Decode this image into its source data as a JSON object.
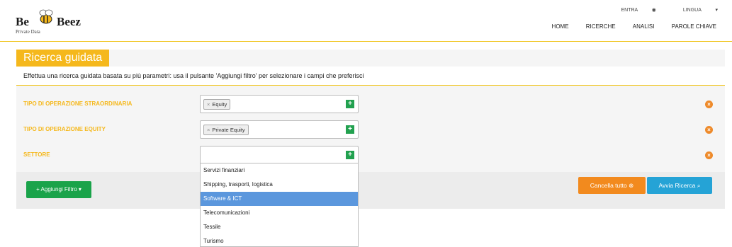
{
  "brand": {
    "name_left": "Be",
    "name_right": "Beez",
    "tagline": "Private Data"
  },
  "top_links": {
    "login": "ENTRA",
    "language": "LINGUA"
  },
  "nav": [
    "HOME",
    "RICERCHE",
    "ANALISI",
    "PAROLE CHIAVE"
  ],
  "page": {
    "title": "Ricerca guidata",
    "intro": "Effettua una ricerca guidata basata su più parametri: usa il pulsante 'Aggiungi filtro' per selezionare i campi che preferisci"
  },
  "filters": [
    {
      "label": "TIPO DI OPERAZIONE STRAORDINARIA",
      "tag": "Equity"
    },
    {
      "label": "TIPO DI OPERAZIONE EQUITY",
      "tag": "Private Equity"
    },
    {
      "label": "SETTORE",
      "tag": ""
    }
  ],
  "dropdown": [
    "Servizi finanziari",
    "Shipping, trasporti, logistica",
    "Software & ICT",
    "Telecomunicazioni",
    "Tessile",
    "Turismo"
  ],
  "dropdown_highlight": "Software & ICT",
  "buttons": {
    "add_filter": "Aggiungi Filtro",
    "cancel_all": "Cancella tutto",
    "start_search": "Avvia Ricerca"
  },
  "colors": {
    "accent": "#f5b81c",
    "green": "#1aa34a",
    "orange": "#f28a1e",
    "blue": "#25a3d6",
    "highlight": "#5b97dd"
  }
}
